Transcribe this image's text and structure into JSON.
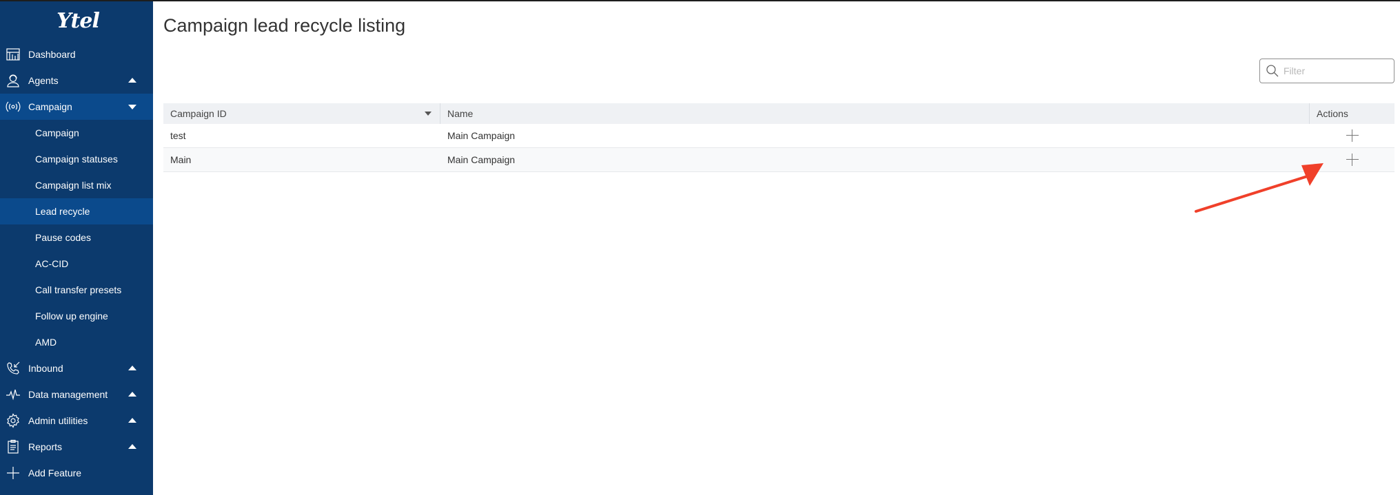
{
  "brand": {
    "logo_text": "Ytel"
  },
  "sidebar": {
    "items": [
      {
        "label": "Dashboard",
        "icon": "dashboard-icon"
      },
      {
        "label": "Agents",
        "icon": "agents-icon",
        "caret": "up"
      },
      {
        "label": "Campaign",
        "icon": "campaign-icon",
        "caret": "down",
        "active": true
      },
      {
        "label": "Campaign",
        "sub": true
      },
      {
        "label": "Campaign statuses",
        "sub": true
      },
      {
        "label": "Campaign list mix",
        "sub": true
      },
      {
        "label": "Lead recycle",
        "sub": true,
        "active": true
      },
      {
        "label": "Pause codes",
        "sub": true
      },
      {
        "label": "AC-CID",
        "sub": true
      },
      {
        "label": "Call transfer presets",
        "sub": true
      },
      {
        "label": "Follow up engine",
        "sub": true
      },
      {
        "label": "AMD",
        "sub": true
      },
      {
        "label": "Inbound",
        "icon": "inbound-icon",
        "caret": "up"
      },
      {
        "label": "Data management",
        "icon": "data-management-icon",
        "caret": "up"
      },
      {
        "label": "Admin utilities",
        "icon": "gear-icon",
        "caret": "up"
      },
      {
        "label": "Reports",
        "icon": "reports-icon",
        "caret": "up"
      },
      {
        "label": "Add Feature",
        "icon": "plus-icon"
      }
    ]
  },
  "page": {
    "title": "Campaign lead recycle listing"
  },
  "filter": {
    "placeholder": "Filter"
  },
  "table": {
    "columns": [
      "Campaign ID",
      "Name",
      "Actions"
    ],
    "rows": [
      {
        "campaign_id": "test",
        "name": "Main Campaign"
      },
      {
        "campaign_id": "Main",
        "name": "Main Campaign"
      }
    ]
  },
  "colors": {
    "sidebar_bg": "#0c3a6d",
    "sidebar_active": "#0b4a8c",
    "header_bg": "#eff1f4",
    "annotation_arrow": "#f0402a"
  }
}
